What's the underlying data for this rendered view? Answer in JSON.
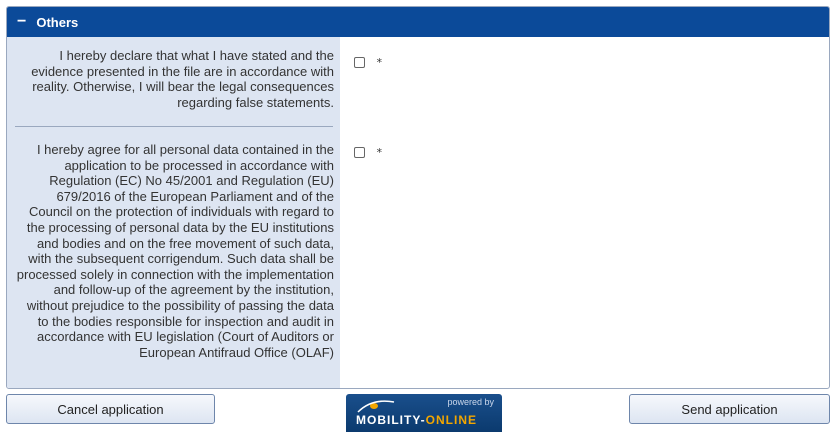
{
  "section": {
    "title": "Others",
    "collapse_symbol": "−"
  },
  "declarations": [
    {
      "text": "I hereby declare that what I have stated and the evidence presented in the file are in accordance with reality. Otherwise, I will bear the legal consequences regarding false statements.",
      "required_mark": "*",
      "checked": false
    },
    {
      "text": "I hereby agree for all personal data contained in the application to be processed in accordance with Regulation (EC) No 45/2001 and Regulation (EU) 679/2016 of the European Parliament and of the Council on the protection of individuals with regard to the processing of personal data by the EU institutions and bodies and on the free movement of such data, with the subsequent corrigendum. Such data shall be processed solely in connection with the implementation and follow-up of the agreement by the institution, without prejudice to the possibility of passing the data to the bodies responsible for inspection and audit in accordance with EU legislation (Court of Auditors or European Antifraud Office (OLAF)",
      "required_mark": "*",
      "checked": false
    }
  ],
  "buttons": {
    "cancel": "Cancel application",
    "send": "Send application"
  },
  "logo": {
    "powered_by": "powered by",
    "brand_main": "MOBILITY-",
    "brand_accent": "ONLINE"
  },
  "colors": {
    "header_bg": "#0b4a99",
    "label_col_bg": "#dde5f2",
    "logo_accent": "#f2a600"
  }
}
